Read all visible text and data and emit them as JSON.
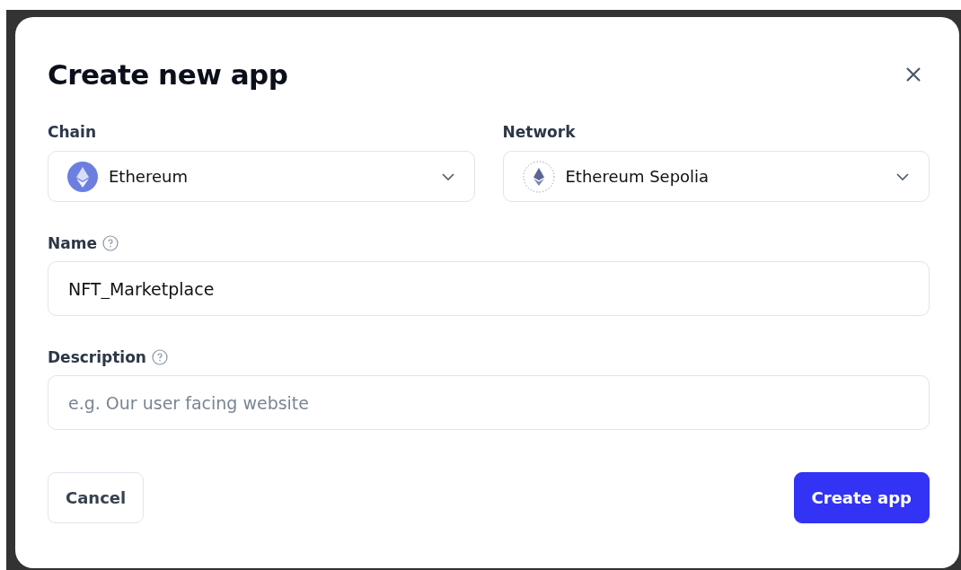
{
  "dialog": {
    "title": "Create new app"
  },
  "selects": [
    {
      "label": "Chain",
      "value": "Ethereum",
      "kind": "filled"
    },
    {
      "label": "Network",
      "value": "Ethereum Sepolia",
      "kind": "dotted"
    }
  ],
  "fields": [
    {
      "label": "Name",
      "value": "NFT_Marketplace"
    },
    {
      "label": "Description",
      "placeholder": "e.g. Our user facing website"
    }
  ],
  "buttons": [
    {
      "label": "Cancel",
      "kind": "secondary"
    },
    {
      "label": "Create app",
      "kind": "primary"
    }
  ]
}
